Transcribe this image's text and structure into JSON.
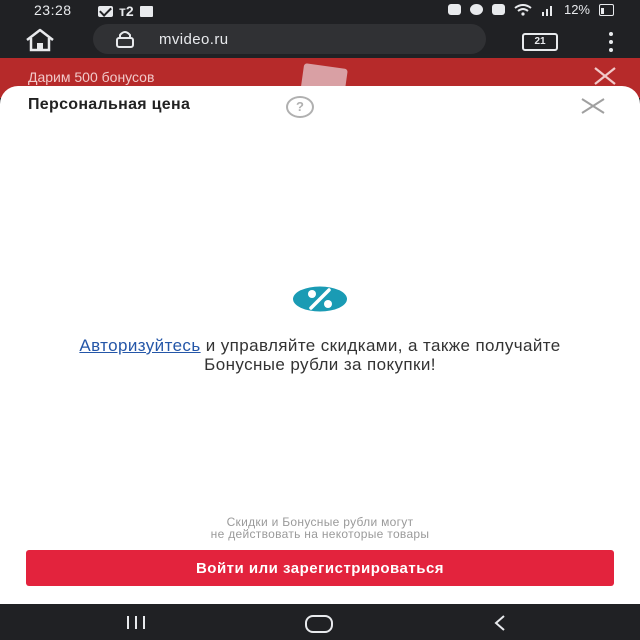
{
  "status_bar": {
    "time": "23:28",
    "carrier": "т2",
    "battery": "12%",
    "icons": [
      "mail-icon",
      "image-icon",
      "alarm-icon",
      "clock-icon",
      "mute-icon",
      "wifi-icon",
      "signal-icon",
      "battery-icon"
    ]
  },
  "browser": {
    "url": "mvideo.ru",
    "tab_count": "21",
    "icons": [
      "home-icon",
      "lock-icon",
      "tabs-icon",
      "menu-dots-icon"
    ]
  },
  "promo": {
    "text": "Дарим 500 бонусов"
  },
  "sheet": {
    "title": "Персональная цена",
    "help_symbol": "?",
    "auth_link": "Авторизуйтесь",
    "auth_text_rest": " и управляйте скидками, а также получайте Бонусные рубли за покупки!",
    "disclaimer_line1": "Скидки и Бонусные рубли могут",
    "disclaimer_line2": "не действовать на некоторые товары",
    "login_button": "Войти или зарегистрироваться"
  },
  "colors": {
    "accent": "#e3233d",
    "banner": "#b62a2a",
    "percent_icon": "#1a9bb4",
    "link": "#2456a8",
    "system_bar": "#202124"
  }
}
